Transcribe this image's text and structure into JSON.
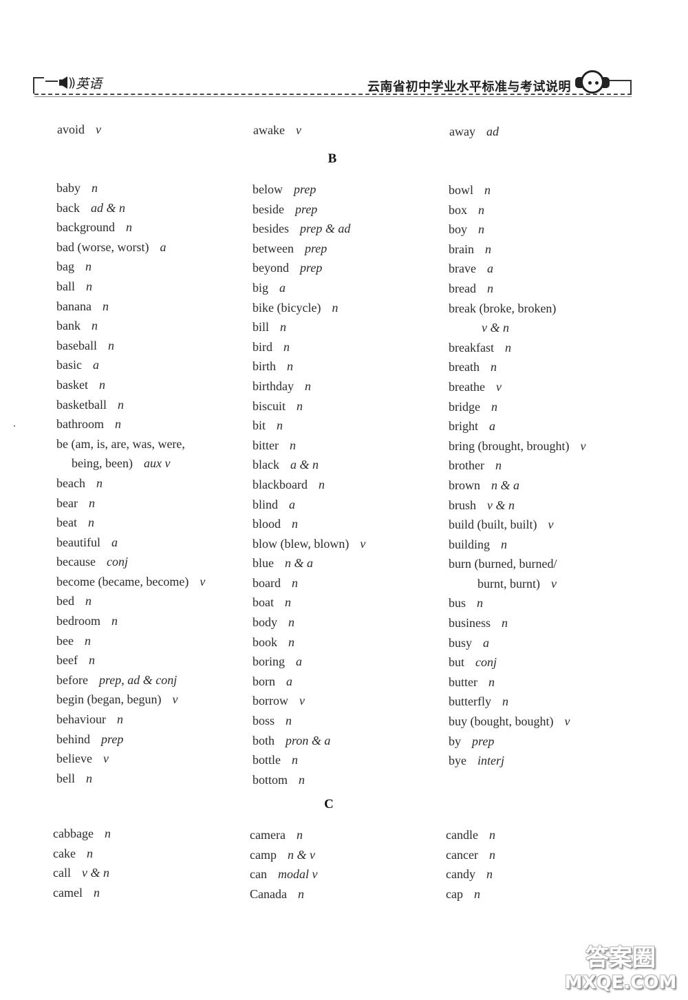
{
  "header": {
    "subject": "英语",
    "book_title": "云南省初中学业水平标准与考试说明"
  },
  "sections": {
    "A_tail": [
      [
        {
          "w": "avoid",
          "p": "v"
        }
      ],
      [
        {
          "w": "awake",
          "p": "v"
        }
      ],
      [
        {
          "w": "away",
          "p": "ad"
        }
      ]
    ],
    "B": {
      "letter": "B",
      "columns": [
        [
          {
            "w": "baby",
            "p": "n"
          },
          {
            "w": "back",
            "p": "ad & n"
          },
          {
            "w": "background",
            "p": "n"
          },
          {
            "w": "bad (worse, worst)",
            "p": "a"
          },
          {
            "w": "bag",
            "p": "n"
          },
          {
            "w": "ball",
            "p": "n"
          },
          {
            "w": "banana",
            "p": "n"
          },
          {
            "w": "bank",
            "p": "n"
          },
          {
            "w": "baseball",
            "p": "n"
          },
          {
            "w": "basic",
            "p": "a"
          },
          {
            "w": "basket",
            "p": "n"
          },
          {
            "w": "basketball",
            "p": "n"
          },
          {
            "w": "bathroom",
            "p": "n"
          },
          {
            "w": "be (am, is, are, was, were,",
            "p": ""
          },
          {
            "w": "being, been)",
            "p": "aux v",
            "cont": 1
          },
          {
            "w": "beach",
            "p": "n"
          },
          {
            "w": "bear",
            "p": "n"
          },
          {
            "w": "beat",
            "p": "n"
          },
          {
            "w": "beautiful",
            "p": "a"
          },
          {
            "w": "because",
            "p": "conj"
          },
          {
            "w": "become (became, become)",
            "p": "v"
          },
          {
            "w": "bed",
            "p": "n"
          },
          {
            "w": "bedroom",
            "p": "n"
          },
          {
            "w": "bee",
            "p": "n"
          },
          {
            "w": "beef",
            "p": "n"
          },
          {
            "w": "before",
            "p": "prep, ad & conj"
          },
          {
            "w": "begin (began, begun)",
            "p": "v"
          },
          {
            "w": "behaviour",
            "p": "n"
          },
          {
            "w": "behind",
            "p": "prep"
          },
          {
            "w": "believe",
            "p": "v"
          },
          {
            "w": "bell",
            "p": "n"
          }
        ],
        [
          {
            "w": "below",
            "p": "prep"
          },
          {
            "w": "beside",
            "p": "prep"
          },
          {
            "w": "besides",
            "p": "prep & ad"
          },
          {
            "w": "between",
            "p": "prep"
          },
          {
            "w": "beyond",
            "p": "prep"
          },
          {
            "w": "big",
            "p": "a"
          },
          {
            "w": "bike (bicycle)",
            "p": "n"
          },
          {
            "w": "bill",
            "p": "n"
          },
          {
            "w": "bird",
            "p": "n"
          },
          {
            "w": "birth",
            "p": "n"
          },
          {
            "w": "birthday",
            "p": "n"
          },
          {
            "w": "biscuit",
            "p": "n"
          },
          {
            "w": "bit",
            "p": "n"
          },
          {
            "w": "bitter",
            "p": "n"
          },
          {
            "w": "black",
            "p": "a & n"
          },
          {
            "w": "blackboard",
            "p": "n"
          },
          {
            "w": "blind",
            "p": "a"
          },
          {
            "w": "blood",
            "p": "n"
          },
          {
            "w": "blow (blew, blown)",
            "p": "v"
          },
          {
            "w": "blue",
            "p": "n & a"
          },
          {
            "w": "board",
            "p": "n"
          },
          {
            "w": "boat",
            "p": "n"
          },
          {
            "w": "body",
            "p": "n"
          },
          {
            "w": "book",
            "p": "n"
          },
          {
            "w": "boring",
            "p": "a"
          },
          {
            "w": "born",
            "p": "a"
          },
          {
            "w": "borrow",
            "p": "v"
          },
          {
            "w": "boss",
            "p": "n"
          },
          {
            "w": "both",
            "p": "pron & a"
          },
          {
            "w": "bottle",
            "p": "n"
          },
          {
            "w": "bottom",
            "p": "n"
          }
        ],
        [
          {
            "w": "bowl",
            "p": "n"
          },
          {
            "w": "box",
            "p": "n"
          },
          {
            "w": "boy",
            "p": "n"
          },
          {
            "w": "brain",
            "p": "n"
          },
          {
            "w": "brave",
            "p": "a"
          },
          {
            "w": "bread",
            "p": "n"
          },
          {
            "w": "break (broke, broken)",
            "p": ""
          },
          {
            "w": "",
            "p": "v & n",
            "cont": 2
          },
          {
            "w": "breakfast",
            "p": "n"
          },
          {
            "w": "breath",
            "p": "n"
          },
          {
            "w": "breathe",
            "p": "v"
          },
          {
            "w": "bridge",
            "p": "n"
          },
          {
            "w": "bright",
            "p": "a"
          },
          {
            "w": "bring (brought, brought)",
            "p": "v"
          },
          {
            "w": "brother",
            "p": "n"
          },
          {
            "w": "brown",
            "p": "n & a"
          },
          {
            "w": "brush",
            "p": "v & n"
          },
          {
            "w": "build (built, built)",
            "p": "v"
          },
          {
            "w": "building",
            "p": "n"
          },
          {
            "w": "burn (burned, burned/",
            "p": ""
          },
          {
            "w": "burnt, burnt)",
            "p": "v",
            "cont": 3
          },
          {
            "w": "bus",
            "p": "n"
          },
          {
            "w": "business",
            "p": "n"
          },
          {
            "w": "busy",
            "p": "a"
          },
          {
            "w": "but",
            "p": "conj"
          },
          {
            "w": "butter",
            "p": "n"
          },
          {
            "w": "butterfly",
            "p": "n"
          },
          {
            "w": "buy (bought, bought)",
            "p": "v"
          },
          {
            "w": "by",
            "p": "prep"
          },
          {
            "w": "bye",
            "p": "interj"
          }
        ]
      ]
    },
    "C": {
      "letter": "C",
      "columns": [
        [
          {
            "w": "cabbage",
            "p": "n"
          },
          {
            "w": "cake",
            "p": "n"
          },
          {
            "w": "call",
            "p": "v & n"
          },
          {
            "w": "camel",
            "p": "n"
          }
        ],
        [
          {
            "w": "camera",
            "p": "n"
          },
          {
            "w": "camp",
            "p": "n & v"
          },
          {
            "w": "can",
            "p": "modal v"
          },
          {
            "w": "Canada",
            "p": "n"
          }
        ],
        [
          {
            "w": "candle",
            "p": "n"
          },
          {
            "w": "cancer",
            "p": "n"
          },
          {
            "w": "candy",
            "p": "n"
          },
          {
            "w": "cap",
            "p": "n"
          }
        ]
      ]
    }
  },
  "watermark": {
    "cn": "答案圈",
    "en": "MXQE.COM"
  }
}
